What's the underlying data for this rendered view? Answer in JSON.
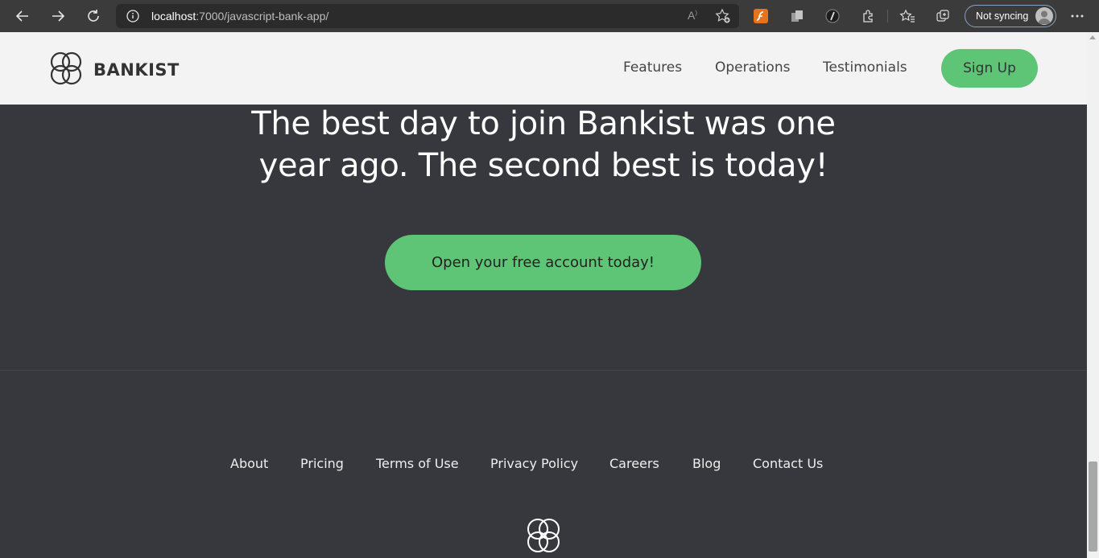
{
  "browser": {
    "url_host": "localhost",
    "url_rest": ":7000/javascript-bank-app/",
    "sync_label": "Not syncing"
  },
  "header": {
    "brand": "BANKIST",
    "nav": [
      "Features",
      "Operations",
      "Testimonials"
    ],
    "signup_label": "Sign Up"
  },
  "cta": {
    "title_line1": "The best day to join Bankist was one",
    "title_line2": "year ago. The second best is today!",
    "button_label": "Open your free account today!"
  },
  "footer": {
    "links": [
      "About",
      "Pricing",
      "Terms of Use",
      "Privacy Policy",
      "Careers",
      "Blog",
      "Contact Us"
    ]
  },
  "colors": {
    "accent": "#5ec576",
    "dark_bg": "#37383d",
    "header_bg": "#f3f3f3"
  },
  "icons": [
    "back-arrow-icon",
    "forward-arrow-icon",
    "refresh-icon",
    "info-icon",
    "read-aloud-icon",
    "add-favorite-icon",
    "extension-icon",
    "favorites-icon",
    "collections-icon",
    "more-icon",
    "bankist-logo-icon"
  ]
}
